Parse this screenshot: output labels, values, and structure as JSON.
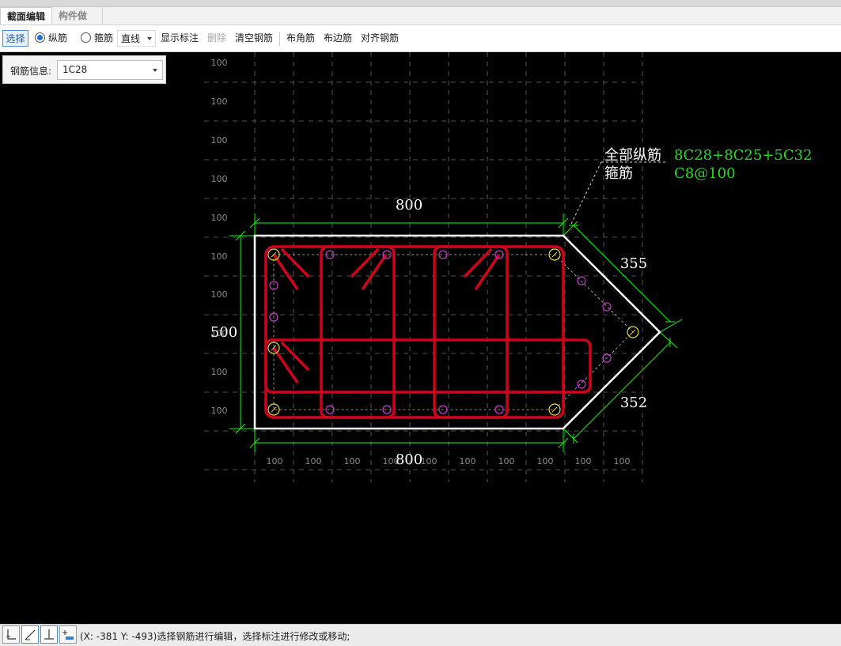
{
  "tabs": [
    {
      "label": "截面编辑"
    },
    {
      "label": "构件做法"
    }
  ],
  "toolbar": {
    "select": "选择",
    "longitudinal": "纵筋",
    "stirrup": "箍筋",
    "line_mode": "直线",
    "show_annotation": "显示标注",
    "delete": "删除",
    "clear_rebar": "清空钢筋",
    "corner_rebar": "布角筋",
    "edge_rebar": "布边筋",
    "align_rebar": "对齐钢筋"
  },
  "rebar_info": {
    "label": "钢筋信息:",
    "value": "1C28"
  },
  "drawing": {
    "grid_label": "100",
    "dim_top": "800",
    "dim_bottom": "800",
    "dim_left": "500",
    "dim_upper_right": "355",
    "dim_lower_right": "352",
    "annotation_long_label": "全部纵筋",
    "annotation_long_value": "8C28+8C25+5C32",
    "annotation_stirrup_label": "箍筋",
    "annotation_stirrup_value": "C8@100",
    "colors": {
      "section_outline": "#ffffff",
      "stirrup": "#d0021b",
      "dimension": "#00ff00",
      "annotation_value": "#00ff00",
      "corner_bar": "#e6d84a",
      "edge_bar": "#cc33cc",
      "grid": "#6a6a6a"
    }
  },
  "status": {
    "text": "(X: -381 Y: -493)选择钢筋进行编辑，选择标注进行修改或移动;",
    "icons": [
      "ortho-icon",
      "polar-icon",
      "perpendicular-icon",
      "dimension-icon"
    ]
  }
}
